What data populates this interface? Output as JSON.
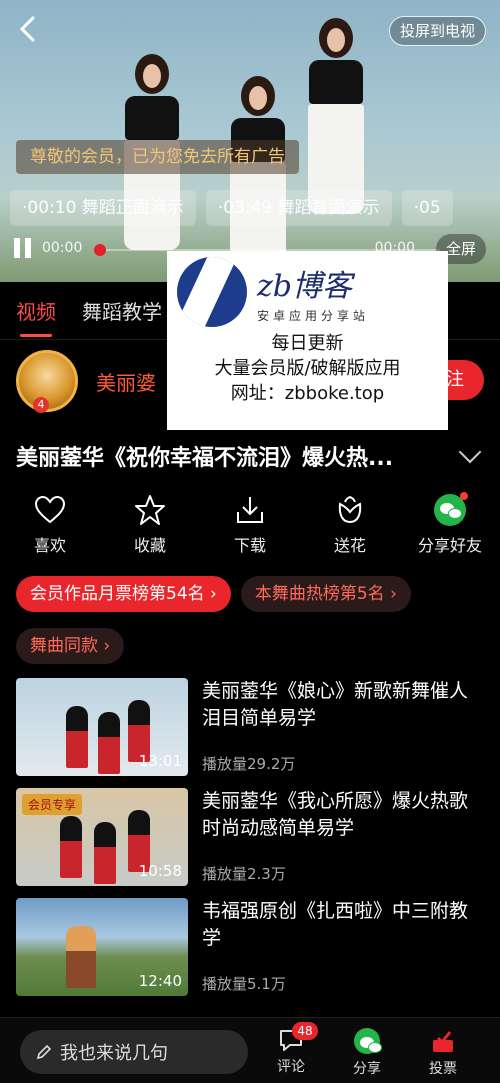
{
  "video": {
    "cast_label": "投屏到电视",
    "vip_notice": "尊敬的会员，已为您免去所有广告",
    "chapters": [
      "·00:10 舞蹈正面演示",
      "·03:49 舞蹈背面演示",
      "·05"
    ],
    "current_time": "00:00",
    "end_time": "00:00",
    "fullscreen_label": "全屏"
  },
  "tabs": [
    {
      "label": "视频",
      "active": true
    },
    {
      "label": "舞蹈教学",
      "active": false
    }
  ],
  "author": {
    "name": "美丽婆",
    "follow_label": "注"
  },
  "watermark": {
    "brand": "zb博客",
    "subtitle": "安卓应用分享站",
    "line1": "每日更新",
    "line2": "大量会员版/破解版应用",
    "line3": "网址：zbboke.top"
  },
  "title": "美丽蓥华《祝你幸福不流泪》爆火热...",
  "actions": [
    {
      "icon": "heart-icon",
      "label": "喜欢"
    },
    {
      "icon": "star-icon",
      "label": "收藏"
    },
    {
      "icon": "download-icon",
      "label": "下载"
    },
    {
      "icon": "flower-icon",
      "label": "送花"
    },
    {
      "icon": "wechat-icon",
      "label": "分享好友"
    }
  ],
  "chips": {
    "monthly_rank": "会员作品月票榜第54名 ›",
    "hot_rank": "本舞曲热榜第5名 ›",
    "same_song": "舞曲同款 ›"
  },
  "related": [
    {
      "title": "美丽蓥华《娘心》新歌新舞催人泪目简单易学",
      "plays": "播放量29.2万",
      "duration": "13:01",
      "tag": ""
    },
    {
      "title": "美丽蓥华《我心所愿》爆火热歌时尚动感简单易学",
      "plays": "播放量2.3万",
      "duration": "10:58",
      "tag": "会员专享"
    },
    {
      "title": "韦福强原创《扎西啦》中三附教学",
      "plays": "播放量5.1万",
      "duration": "12:40",
      "tag": ""
    }
  ],
  "bottom": {
    "comment_placeholder": "我也来说几句",
    "comment_label": "评论",
    "comment_count": "48",
    "share_label": "分享",
    "vote_label": "投票"
  }
}
